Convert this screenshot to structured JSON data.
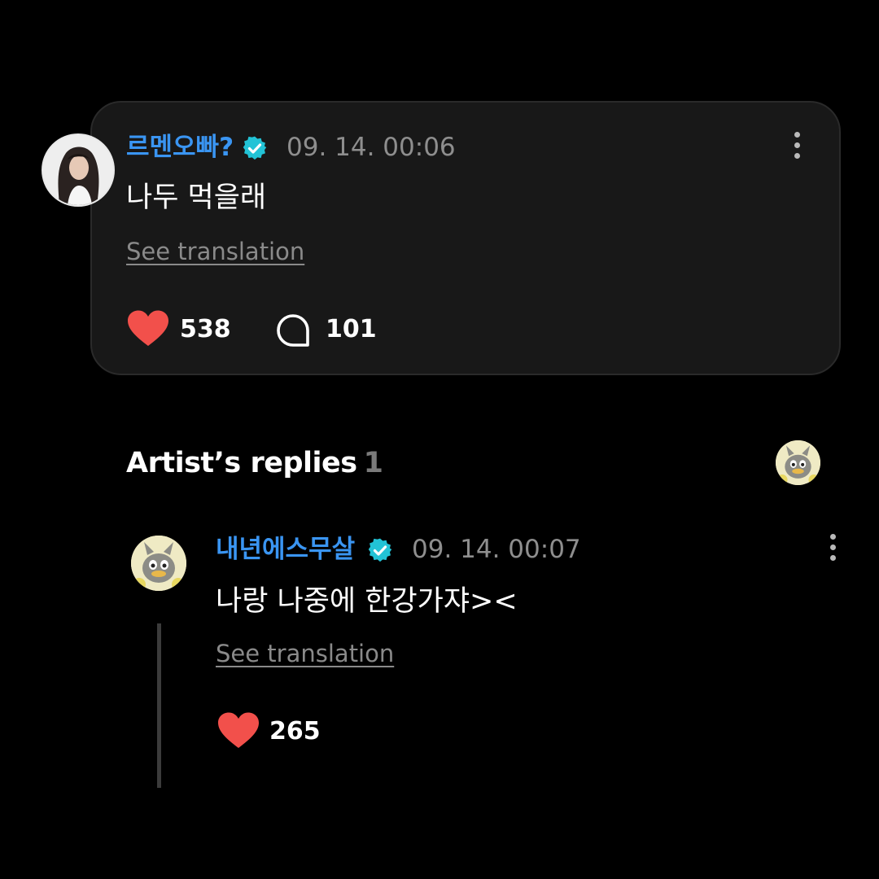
{
  "comment": {
    "author": "르멘오빠?",
    "timestamp": "09. 14. 00:06",
    "text": "나두 먹을래",
    "translate_label": "See translation",
    "likes": "538",
    "replies": "101",
    "avatar": "user-portrait"
  },
  "artist_replies": {
    "title": "Artist’s replies",
    "count": "1",
    "reply": {
      "author": "내년에스무살",
      "timestamp": "09. 14. 00:07",
      "text": "나랑 나중에 한강가쟈><",
      "translate_label": "See translation",
      "likes": "265",
      "avatar": "cartoon-duck"
    }
  },
  "icons": {
    "verified": "verified-badge-icon",
    "like": "heart-icon",
    "comment": "comment-bubble-icon",
    "more": "more-vertical-icon"
  },
  "colors": {
    "background": "#000000",
    "card": "#181818",
    "author_name": "#3a95f2",
    "verified_badge": "#22c3d6",
    "heart": "#f2504b",
    "muted_text": "#8e8e8e"
  }
}
